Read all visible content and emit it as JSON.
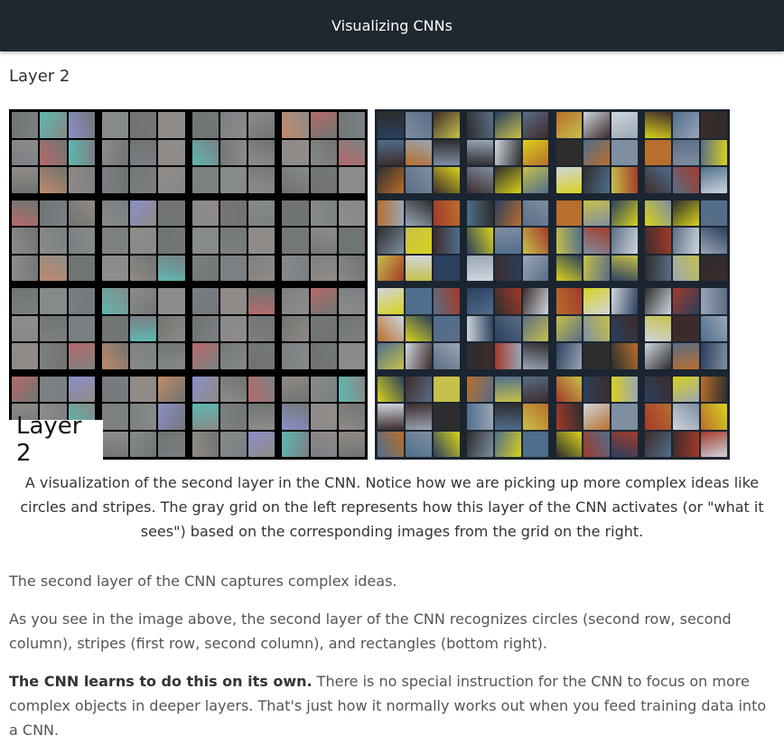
{
  "header": {
    "title": "Visualizing CNNs"
  },
  "section": {
    "title": "Layer 2"
  },
  "figure": {
    "label": "Layer 2",
    "caption": "A visualization of the second layer in the CNN. Notice how we are picking up more complex ideas like circles and stripes. The gray grid on the left represents how this layer of the CNN activates (or \"what it sees\") based on the corresponding images from the grid on the right."
  },
  "paragraphs": {
    "p1": "The second layer of the CNN captures complex ideas.",
    "p2": "As you see in the image above, the second layer of the CNN recognizes circles (second row, second column), stripes (first row, second column), and rectangles (bottom right).",
    "p3_bold": "The CNN learns to do this on its own.",
    "p3_rest": " There is no special instruction for the CNN to focus on more complex objects in deeper layers. That's just how it normally works out when you feed training data into a CNN."
  },
  "colors": {
    "header_bg": "#1f272f",
    "left_panel_bg": "#000000",
    "right_panel_bg": "#1b2531"
  }
}
